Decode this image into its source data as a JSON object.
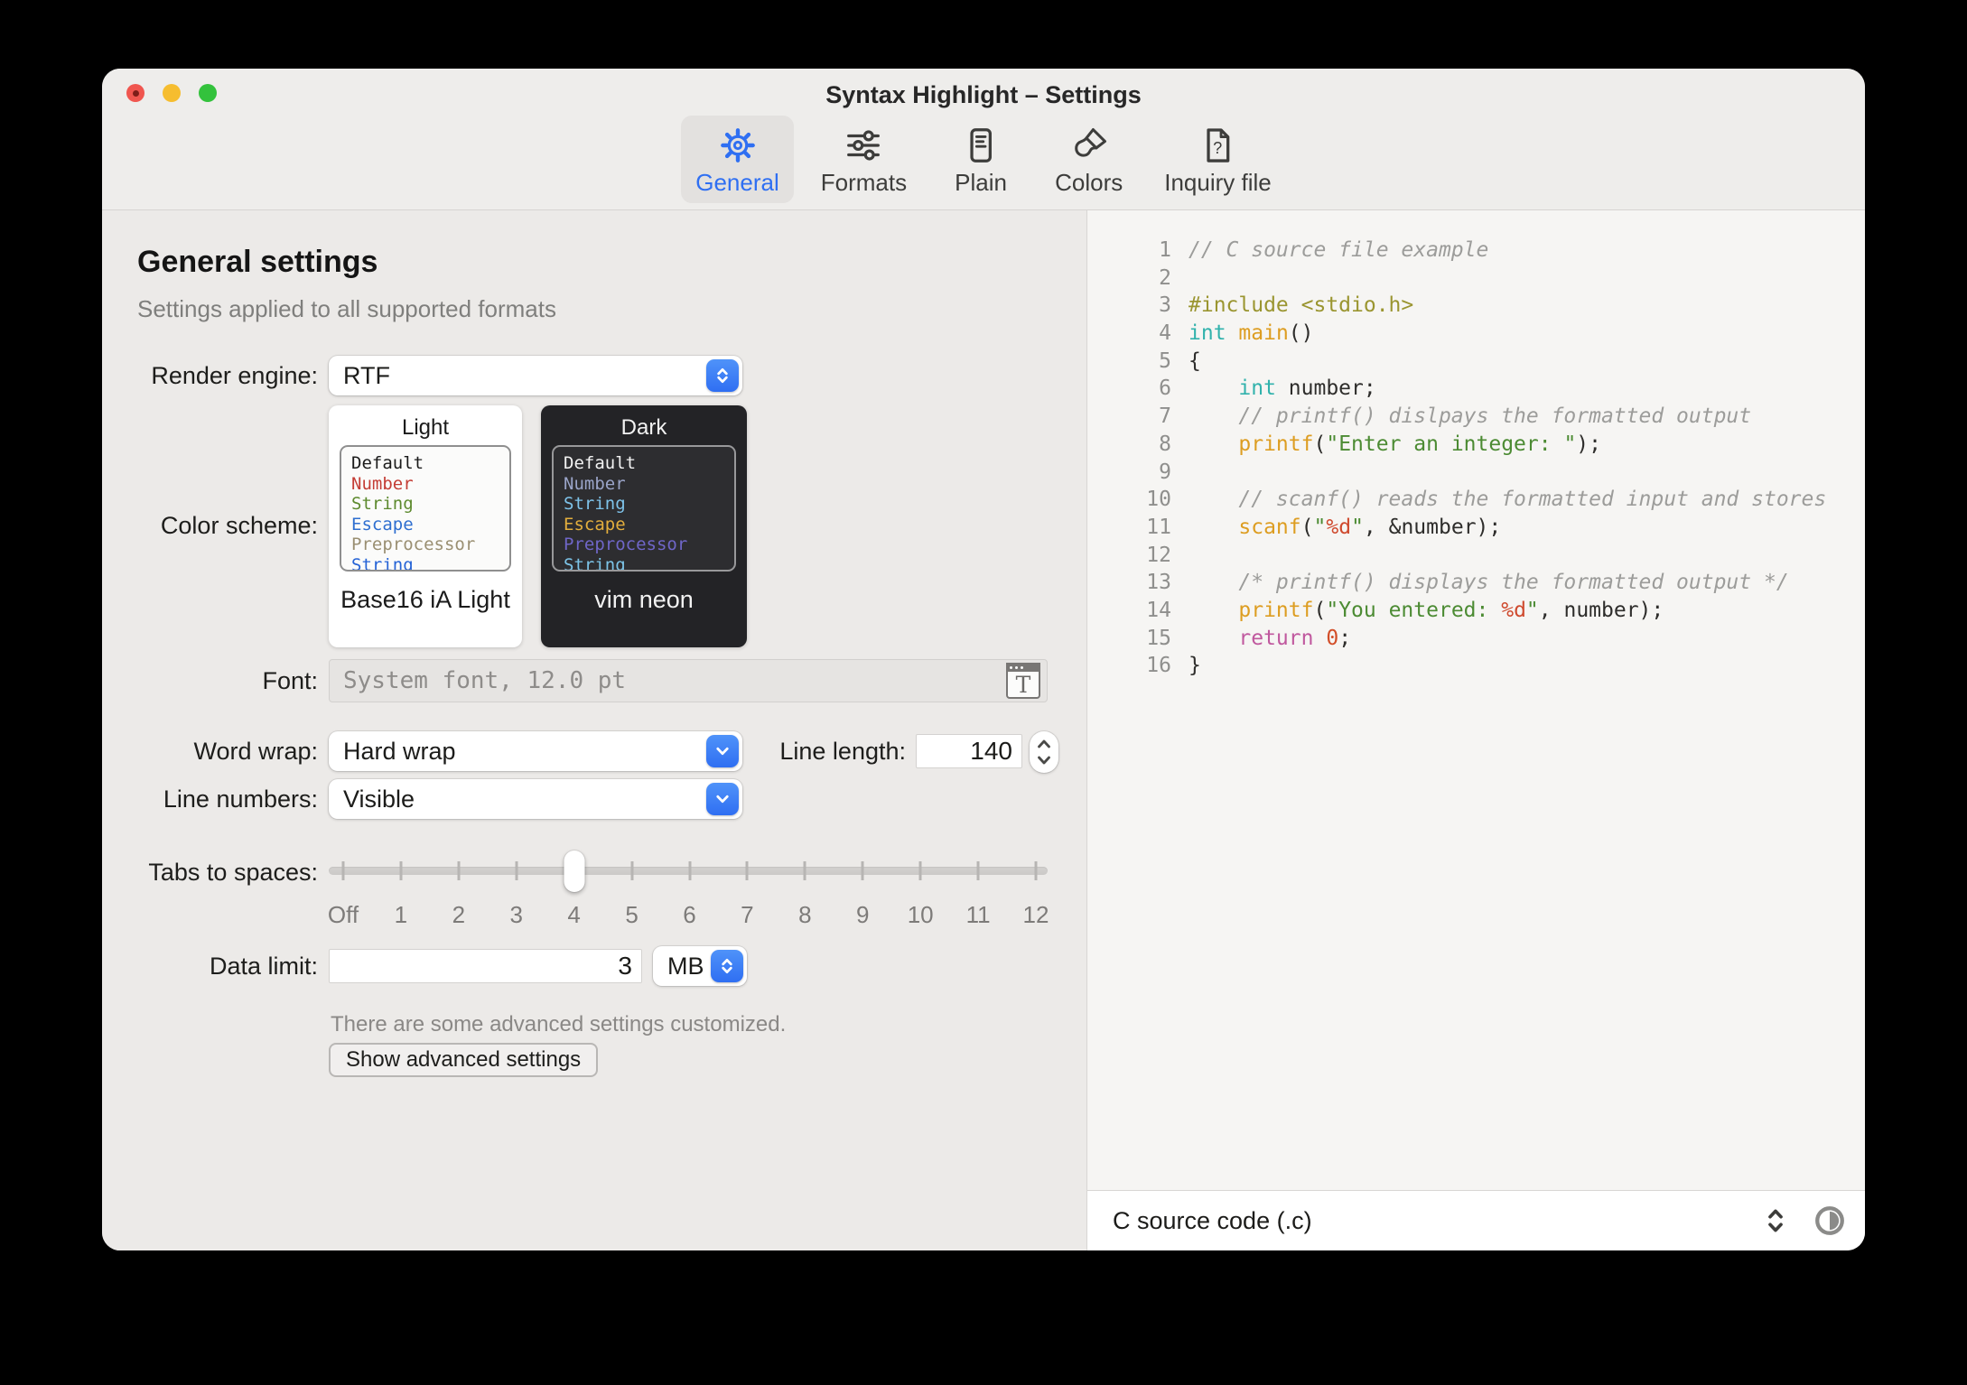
{
  "window": {
    "title": "Syntax Highlight – Settings"
  },
  "toolbar": {
    "tabs": [
      {
        "label": "General",
        "icon": "gear",
        "selected": true
      },
      {
        "label": "Formats",
        "icon": "sliders",
        "selected": false
      },
      {
        "label": "Plain",
        "icon": "document",
        "selected": false
      },
      {
        "label": "Colors",
        "icon": "paintbrush",
        "selected": false
      },
      {
        "label": "Inquiry file",
        "icon": "document-question",
        "selected": false
      }
    ]
  },
  "general": {
    "heading": "General settings",
    "subheading": "Settings applied to all supported formats",
    "render_engine": {
      "label": "Render engine:",
      "value": "RTF"
    },
    "color_scheme": {
      "label": "Color scheme:",
      "light": {
        "title": "Light",
        "name": "Base16 iA Light",
        "card_bg": "#ffffff",
        "box_bg": "#fbfbfa",
        "box_border": "#8f8f8f",
        "text": "#1b1b1b",
        "tokens": [
          {
            "text": "Default",
            "color": "#1b1b1b"
          },
          {
            "text": "Number",
            "color": "#c43d35"
          },
          {
            "text": "String",
            "color": "#5d8a2e"
          },
          {
            "text": "Escape",
            "color": "#2f6fd0"
          },
          {
            "text": "Preprocessor",
            "color": "#9a8f72"
          },
          {
            "text": "String",
            "color": "#2563d6"
          }
        ]
      },
      "dark": {
        "title": "Dark",
        "name": "vim neon",
        "card_bg": "#232326",
        "box_bg": "#2d2d30",
        "box_border": "#98989a",
        "text": "#f2f2f2",
        "tokens": [
          {
            "text": "Default",
            "color": "#f2f2f2"
          },
          {
            "text": "Number",
            "color": "#9aa4c8"
          },
          {
            "text": "String",
            "color": "#7ec3ea"
          },
          {
            "text": "Escape",
            "color": "#e3ae3d"
          },
          {
            "text": "Preprocessor",
            "color": "#6f66c8"
          },
          {
            "text": "String",
            "color": "#7cc4e8"
          }
        ]
      }
    },
    "font": {
      "label": "Font:",
      "value": "System font, 12.0 pt"
    },
    "word_wrap": {
      "label": "Word wrap:",
      "value": "Hard wrap"
    },
    "line_length": {
      "label": "Line length:",
      "value": "140"
    },
    "line_numbers": {
      "label": "Line numbers:",
      "value": "Visible"
    },
    "tabs_to_spaces": {
      "label": "Tabs to spaces:",
      "ticks": [
        "Off",
        "1",
        "2",
        "3",
        "4",
        "5",
        "6",
        "7",
        "8",
        "9",
        "10",
        "11",
        "12"
      ],
      "selected_index": 4
    },
    "data_limit": {
      "label": "Data limit:",
      "value": "3",
      "unit": "MB"
    },
    "advanced_note": "There are some advanced settings customized.",
    "advanced_button": "Show advanced settings"
  },
  "preview": {
    "token_colors": {
      "p": "#2e2d2b",
      "c": "#9c9c9a",
      "pre": "#9a9530",
      "t": "#31b2ac",
      "f": "#dd9d21",
      "s": "#4c8b33",
      "m": "#cf4a2e",
      "k": "#c0589e",
      "n": "#d24e28"
    },
    "lines": [
      {
        "n": "1",
        "spans": [
          [
            "c",
            "// C source file example"
          ]
        ]
      },
      {
        "n": "2",
        "spans": []
      },
      {
        "n": "3",
        "spans": [
          [
            "pre",
            "#include <stdio.h>"
          ]
        ]
      },
      {
        "n": "4",
        "spans": [
          [
            "t",
            "int"
          ],
          [
            "p",
            " "
          ],
          [
            "f",
            "main"
          ],
          [
            "p",
            "()"
          ]
        ]
      },
      {
        "n": "5",
        "spans": [
          [
            "p",
            "{"
          ]
        ]
      },
      {
        "n": "6",
        "spans": [
          [
            "p",
            "    "
          ],
          [
            "t",
            "int"
          ],
          [
            "p",
            " number;"
          ]
        ]
      },
      {
        "n": "7",
        "spans": [
          [
            "p",
            "    "
          ],
          [
            "c",
            "// printf() dislpays the formatted output"
          ]
        ]
      },
      {
        "n": "8",
        "spans": [
          [
            "p",
            "    "
          ],
          [
            "f",
            "printf"
          ],
          [
            "p",
            "("
          ],
          [
            "s",
            "\"Enter an integer: \""
          ],
          [
            "p",
            ");"
          ]
        ]
      },
      {
        "n": "9",
        "spans": []
      },
      {
        "n": "10",
        "spans": [
          [
            "p",
            "    "
          ],
          [
            "c",
            "// scanf() reads the formatted input and stores"
          ]
        ]
      },
      {
        "n": "11",
        "spans": [
          [
            "p",
            "    "
          ],
          [
            "f",
            "scanf"
          ],
          [
            "p",
            "("
          ],
          [
            "s",
            "\""
          ],
          [
            "m",
            "%d"
          ],
          [
            "s",
            "\""
          ],
          [
            "p",
            ", &number);"
          ]
        ]
      },
      {
        "n": "12",
        "spans": []
      },
      {
        "n": "13",
        "spans": [
          [
            "p",
            "    "
          ],
          [
            "c",
            "/* printf() displays the formatted output */"
          ]
        ]
      },
      {
        "n": "14",
        "spans": [
          [
            "p",
            "    "
          ],
          [
            "f",
            "printf"
          ],
          [
            "p",
            "("
          ],
          [
            "s",
            "\"You entered: "
          ],
          [
            "m",
            "%d"
          ],
          [
            "s",
            "\""
          ],
          [
            "p",
            ", number);"
          ]
        ]
      },
      {
        "n": "15",
        "spans": [
          [
            "p",
            "    "
          ],
          [
            "k",
            "return"
          ],
          [
            "p",
            " "
          ],
          [
            "n",
            "0"
          ],
          [
            "p",
            ";"
          ]
        ]
      },
      {
        "n": "16",
        "spans": [
          [
            "p",
            "}"
          ]
        ]
      }
    ],
    "footer": {
      "file_type": "C source code (.c)"
    }
  },
  "colors": {
    "accent": "#2f6ff2"
  }
}
